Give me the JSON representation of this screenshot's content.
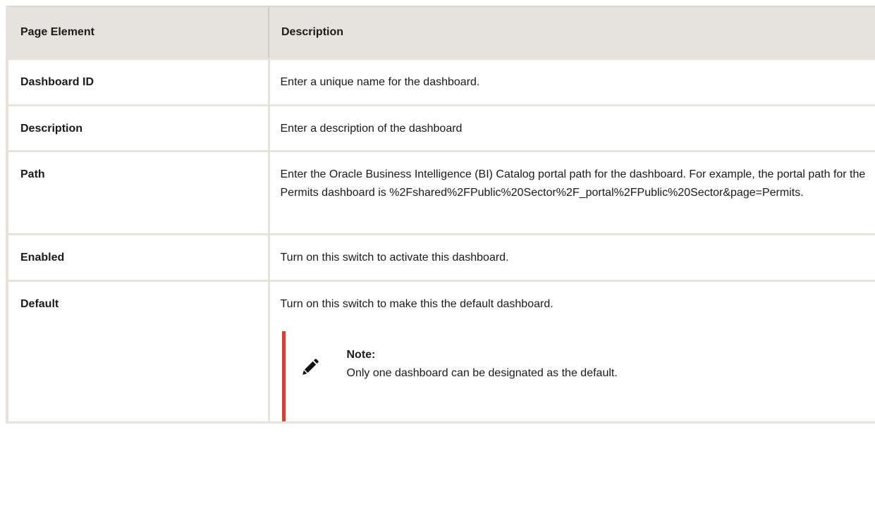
{
  "table": {
    "headers": [
      "Page Element",
      "Description"
    ],
    "rows": [
      {
        "element": "Dashboard ID",
        "description": "Enter a unique name for the dashboard."
      },
      {
        "element": "Description",
        "description": "Enter a description of the dashboard"
      },
      {
        "element": "Path",
        "description": "Enter the Oracle Business Intelligence (BI) Catalog portal path for the dashboard. For example, the portal path for the Permits dashboard is %2Fshared%2FPublic%20Sector%2F_portal%2FPublic%20Sector&page=Permits."
      },
      {
        "element": "Enabled",
        "description": "Turn on this switch to activate this dashboard."
      },
      {
        "element": "Default",
        "description": "Turn on this switch to make this the default dashboard."
      }
    ],
    "note": {
      "icon": "pencil-icon",
      "title": "Note:",
      "text": "Only one dashboard can be designated as the default."
    }
  },
  "colors": {
    "header_bg": "#e6e3dd",
    "note_accent": "#c74634"
  }
}
